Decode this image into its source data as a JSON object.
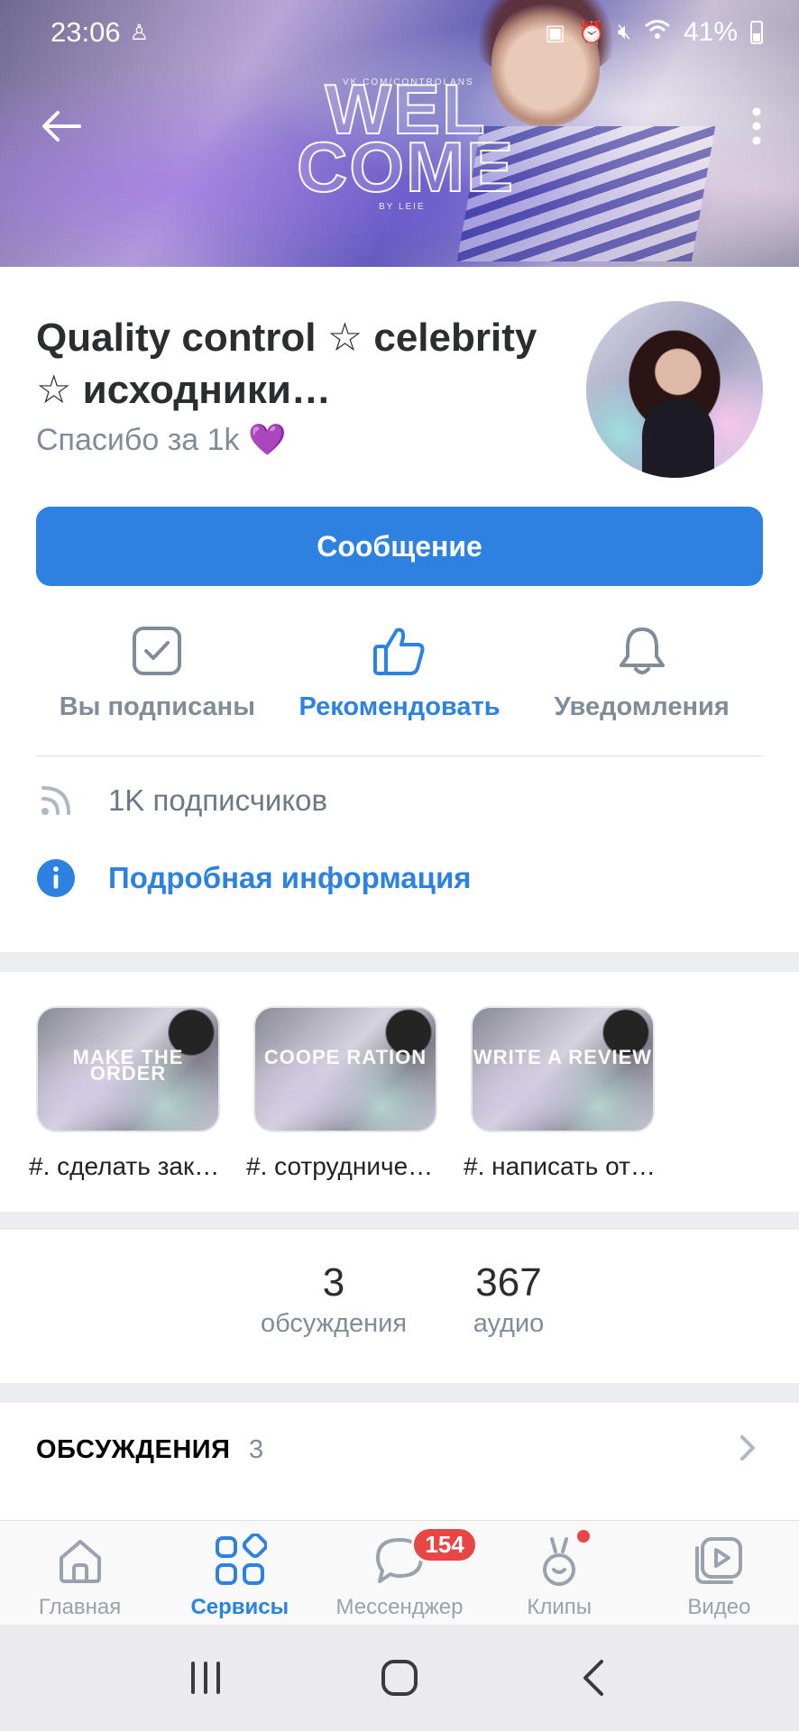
{
  "status_bar": {
    "time": "23:06",
    "battery": "41%"
  },
  "cover": {
    "welcome_line1": "WEL",
    "welcome_line2": "COME",
    "small_top": "VK.COM/CONTROLANS",
    "small_bottom": "BY LEIE"
  },
  "group": {
    "name": "Quality control ☆ celebrity ☆ исходники…",
    "status": "Спасибо за 1k 💜",
    "message_button": "Сообщение"
  },
  "actions": [
    {
      "label": "Вы подписаны",
      "icon": "checkbox-icon"
    },
    {
      "label": "Рекомендовать",
      "icon": "thumbs-up-icon"
    },
    {
      "label": "Уведомления",
      "icon": "bell-icon"
    }
  ],
  "info": {
    "subscribers": "1K подписчиков",
    "details_link": "Подробная информация"
  },
  "links": [
    {
      "thumb_text": "MAKE THE ORDER",
      "label": "#. сделать зак…"
    },
    {
      "thumb_text": "COOPE RATION",
      "label": "#. сотрудниче…"
    },
    {
      "thumb_text": "WRITE A REVIEW",
      "label": "#. написать от…"
    }
  ],
  "counters": [
    {
      "value": "3",
      "label": "обсуждения"
    },
    {
      "value": "367",
      "label": "аудио"
    }
  ],
  "discussions": {
    "title": "ОБСУЖДЕНИЯ",
    "count": "3"
  },
  "tabbar": [
    {
      "label": "Главная",
      "icon": "home-icon"
    },
    {
      "label": "Сервисы",
      "icon": "services-icon"
    },
    {
      "label": "Мессенджер",
      "icon": "messenger-icon",
      "badge": "154"
    },
    {
      "label": "Клипы",
      "icon": "clips-icon"
    },
    {
      "label": "Видео",
      "icon": "video-icon"
    }
  ],
  "colors": {
    "accent": "#2d81e0",
    "badge": "#e64646",
    "secondary_text": "#818c99"
  }
}
